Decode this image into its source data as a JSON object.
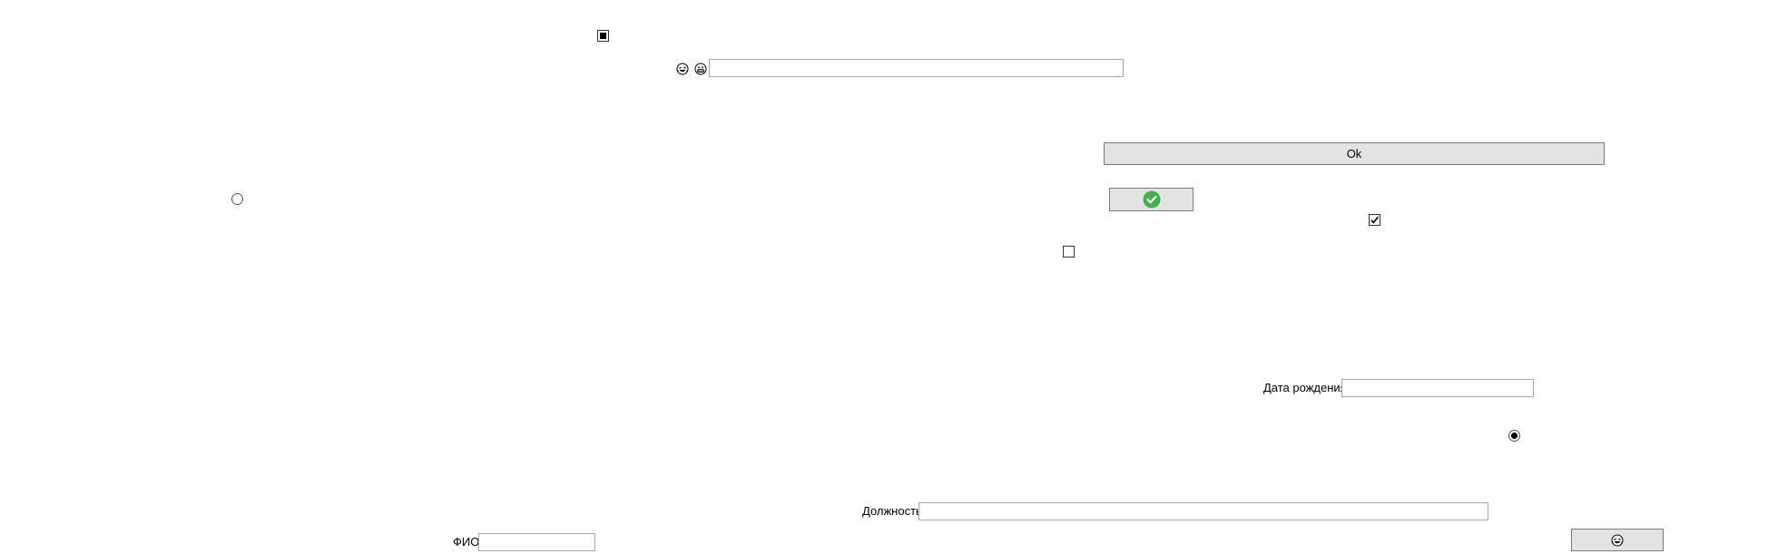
{
  "controls": {
    "indeterminate_checkbox": {
      "state": "indeterminate",
      "icon": "square-filled-icon"
    },
    "emoji_icons": [
      "laughing-face-icon",
      "grinning-face-icon"
    ],
    "top_text_field": {
      "value": "",
      "placeholder": ""
    },
    "ok_button": {
      "label": "Ok"
    },
    "check_button": {
      "icon": "green-check-circle-icon",
      "color": "#3cb44b"
    },
    "checked_checkbox": {
      "checked": true
    },
    "unchecked_checkbox": {
      "checked": false
    },
    "left_radio": {
      "selected": false
    },
    "right_radio": {
      "selected": true
    },
    "birth_date": {
      "label": "Дата рождения",
      "value": ""
    },
    "position": {
      "label": "Должность",
      "value": ""
    },
    "fio": {
      "label": "ФИО",
      "value": ""
    },
    "emoji_button": {
      "icon": "laughing-face-icon"
    }
  }
}
